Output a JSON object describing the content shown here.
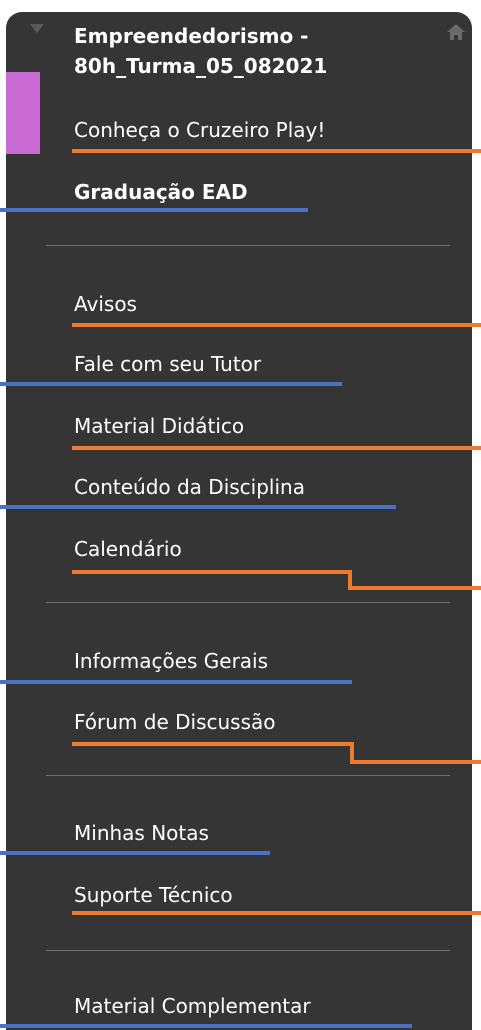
{
  "course": {
    "title_line1": "Empreendedorismo -",
    "title_line2": "80h_Turma_05_082021"
  },
  "colors": {
    "panel": "#353535",
    "accent": "#c86ad2",
    "orange": "#ee7a2e",
    "blue": "#4a72c4",
    "divider": "#6e6e6e",
    "text": "#ffffff"
  },
  "icons": {
    "collapse": "chevron-down-icon",
    "home": "home-icon"
  },
  "menu": {
    "cruzeiro_play": "Conheça o Cruzeiro Play!",
    "graduacao": "Graduação EAD",
    "avisos": "Avisos",
    "tutor": "Fale com seu Tutor",
    "material_didatico": "Material Didático",
    "conteudo": "Conteúdo da Disciplina",
    "calendario": "Calendário",
    "informacoes": "Informações Gerais",
    "forum": "Fórum de Discussão",
    "notas": "Minhas Notas",
    "suporte": "Suporte Técnico",
    "material_complementar": "Material Complementar"
  }
}
